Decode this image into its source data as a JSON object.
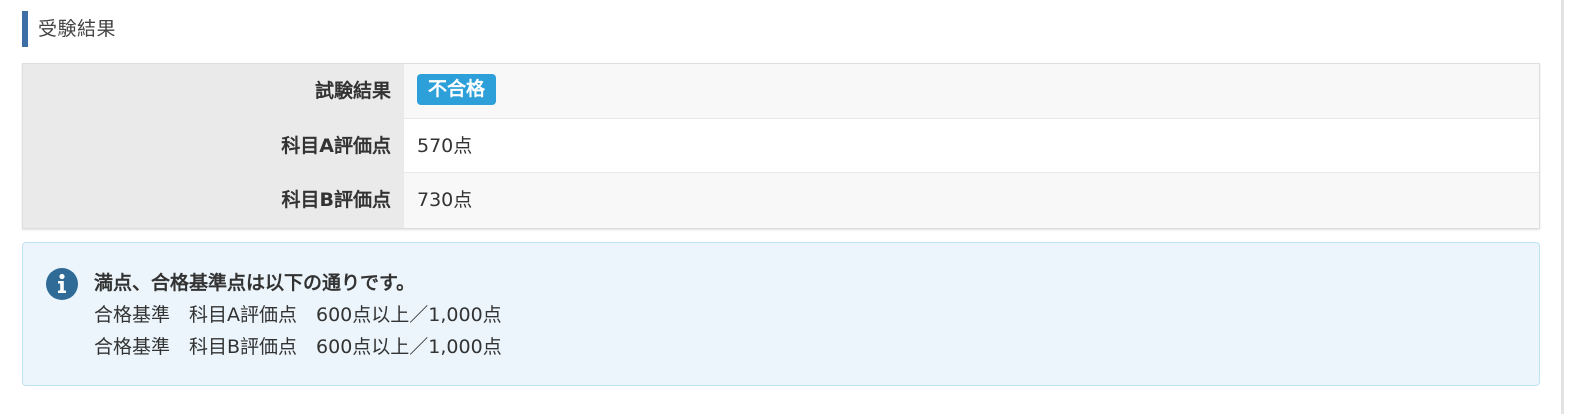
{
  "section": {
    "title": "受験結果"
  },
  "results": [
    {
      "label": "試験結果",
      "value": "不合格",
      "is_badge": true
    },
    {
      "label": "科目A評価点",
      "value": "570点",
      "is_badge": false
    },
    {
      "label": "科目B評価点",
      "value": "730点",
      "is_badge": false
    }
  ],
  "info": {
    "icon": "info-icon",
    "heading": "満点、合格基準点は以下の通りです。",
    "lines": [
      "合格基準　科目A評価点　600点以上／1,000点",
      "合格基準　科目B評価点　600点以上／1,000点"
    ]
  },
  "colors": {
    "title_bar": "#3d6fa6",
    "badge": "#2d9fd9",
    "info_background": "#ebf5fb",
    "info_icon": "#2f6b96"
  }
}
